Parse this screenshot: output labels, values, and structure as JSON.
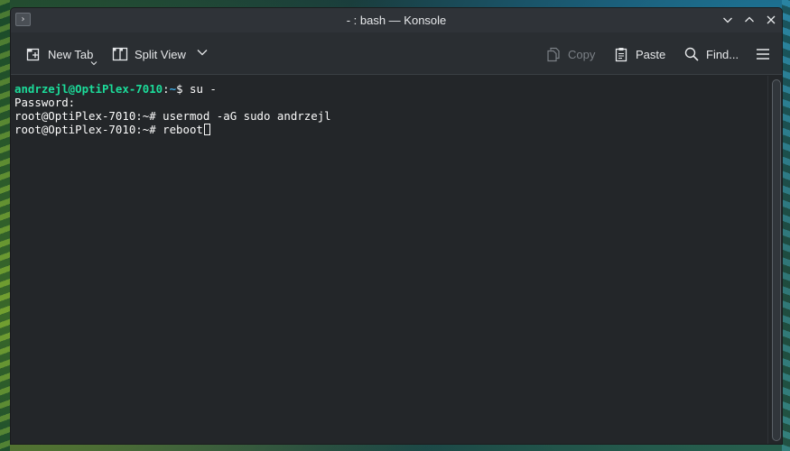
{
  "window": {
    "title": "- : bash — Konsole",
    "app_icon_glyph": "›"
  },
  "toolbar": {
    "new_tab_label": "New Tab",
    "split_view_label": "Split View",
    "copy_label": "Copy",
    "paste_label": "Paste",
    "find_label": "Find..."
  },
  "terminal": {
    "lines": [
      {
        "user_host": "andrzejl@OptiPlex-7010",
        "sep": ":",
        "path": "~",
        "prompt_symbol": "$",
        "command": " su -"
      },
      {
        "text": "Password:"
      },
      {
        "text": "root@OptiPlex-7010:~# usermod -aG sudo andrzejl"
      },
      {
        "text": "root@OptiPlex-7010:~# reboot"
      }
    ]
  },
  "colors": {
    "prompt_user": "#1cdc9a",
    "prompt_path": "#3daee9",
    "terminal_bg": "#232629",
    "terminal_fg": "#fcfcfc"
  }
}
